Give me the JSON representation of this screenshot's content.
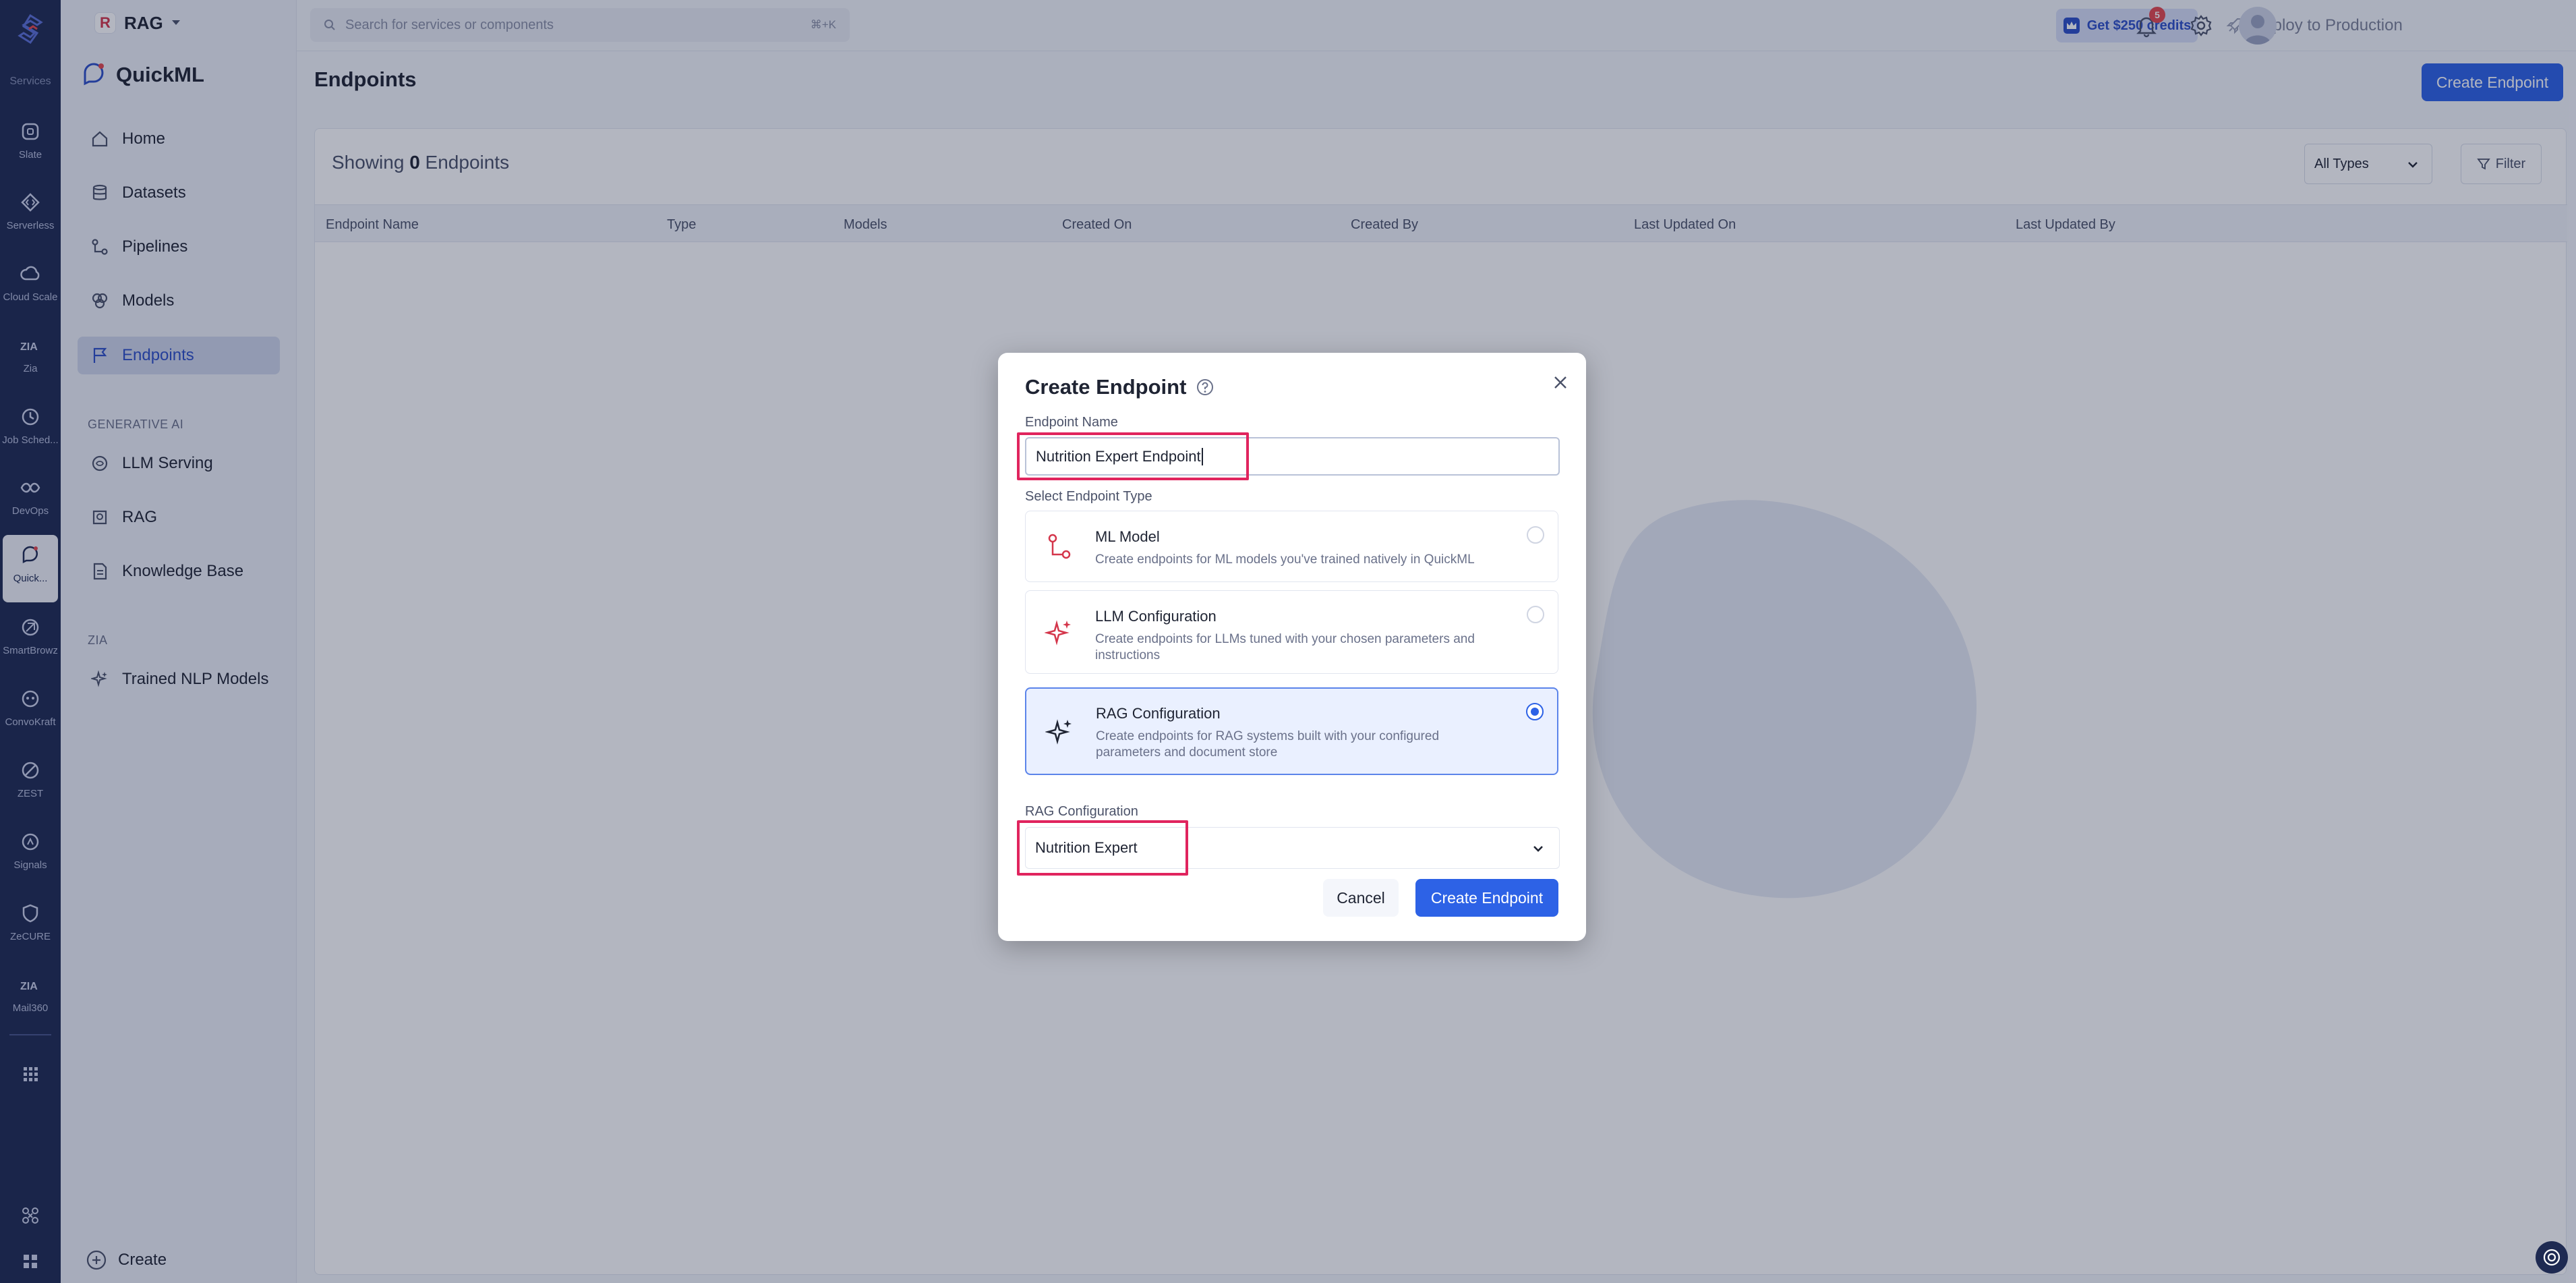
{
  "rail": {
    "services_label": "Services",
    "items": [
      {
        "label": "Slate",
        "icon": "slate-icon"
      },
      {
        "label": "Serverless",
        "icon": "serverless-icon"
      },
      {
        "label": "Cloud Scale",
        "icon": "cloud-scale-icon"
      },
      {
        "label": "Zia",
        "icon": "zia-icon"
      },
      {
        "label": "Job Sched...",
        "icon": "job-scheduling-icon"
      },
      {
        "label": "DevOps",
        "icon": "devops-icon"
      },
      {
        "label": "Quick...",
        "icon": "quickml-icon"
      },
      {
        "label": "SmartBrowz",
        "icon": "smartbrowz-icon"
      },
      {
        "label": "ConvoKraft",
        "icon": "convokraft-icon"
      },
      {
        "label": "ZEST",
        "icon": "zest-icon"
      },
      {
        "label": "Signals",
        "icon": "signals-icon"
      },
      {
        "label": "ZeCURE",
        "icon": "zecure-icon"
      },
      {
        "label": "Mail360",
        "icon": "mail360-icon"
      }
    ]
  },
  "sidebar": {
    "project_badge": "R",
    "project_name": "RAG",
    "brand": "QuickML",
    "items": [
      {
        "label": "Home"
      },
      {
        "label": "Datasets"
      },
      {
        "label": "Pipelines"
      },
      {
        "label": "Models"
      },
      {
        "label": "Endpoints"
      }
    ],
    "section_genai": "GENERATIVE AI",
    "genai_items": [
      {
        "label": "LLM Serving"
      },
      {
        "label": "RAG"
      },
      {
        "label": "Knowledge Base"
      }
    ],
    "section_zia": "ZIA",
    "zia_items": [
      {
        "label": "Trained NLP Models"
      }
    ],
    "create_label": "Create"
  },
  "topbar": {
    "search_placeholder": "Search for services or components",
    "search_shortcut": "⌘+K",
    "credits_label": "Get $250 credits",
    "deploy_label": "Deploy to Production",
    "notification_count": "5"
  },
  "main": {
    "title": "Endpoints",
    "create_button": "Create Endpoint",
    "showing_prefix": "Showing",
    "showing_count": "0",
    "showing_suffix": "Endpoints",
    "type_filter": "All Types",
    "filter_button": "Filter",
    "columns": [
      "Endpoint Name",
      "Type",
      "Models",
      "Created On",
      "Created By",
      "Last Updated On",
      "Last Updated By"
    ]
  },
  "modal": {
    "title": "Create Endpoint",
    "name_label": "Endpoint Name",
    "name_value": "Nutrition Expert Endpoint",
    "type_label": "Select Endpoint Type",
    "options": [
      {
        "title": "ML Model",
        "desc": "Create endpoints for ML models you've trained natively in QuickML"
      },
      {
        "title": "LLM Configuration",
        "desc": "Create endpoints for LLMs tuned with your chosen parameters and instructions"
      },
      {
        "title": "RAG Configuration",
        "desc": "Create endpoints for RAG systems built with your configured parameters and document store"
      }
    ],
    "rag_label": "RAG Configuration",
    "rag_value": "Nutrition Expert",
    "cancel": "Cancel",
    "submit": "Create Endpoint"
  },
  "colors": {
    "accent": "#2d62e6",
    "rail": "#1e2a52",
    "highlight": "#e0245e"
  }
}
